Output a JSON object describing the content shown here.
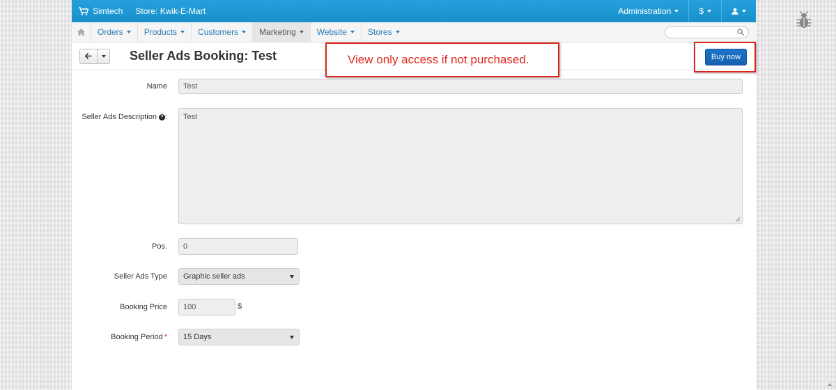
{
  "topbar": {
    "brand": "Simtech",
    "store": "Store: Kwik-E-Mart",
    "administration": "Administration",
    "currency": "$"
  },
  "nav": {
    "items": [
      "Orders",
      "Products",
      "Customers",
      "Marketing",
      "Website",
      "Stores"
    ],
    "active": "Marketing",
    "search_placeholder": ""
  },
  "header": {
    "title": "Seller Ads Booking: Test",
    "annotation": "View only access if not purchased.",
    "buy_label": "Buy now"
  },
  "form": {
    "name_label": "Name",
    "name_value": "Test",
    "description_label": "Seller Ads Description",
    "description_suffix": ":",
    "description_value": "Test",
    "pos_label": "Pos.",
    "pos_value": "0",
    "type_label": "Seller Ads Type",
    "type_value": "Graphic seller ads",
    "price_label": "Booking Price",
    "price_value": "100",
    "price_unit": "$",
    "period_label": "Booking Period",
    "period_required": "*",
    "period_value": "15 Days"
  },
  "colors": {
    "topbar": "#1f96d1",
    "link": "#2a7db8",
    "annotation_red": "#d9271e",
    "buy_button": "#1a6bc0"
  },
  "icons": [
    "cart-icon",
    "home-icon",
    "search-icon",
    "back-arrow-icon",
    "question-icon",
    "user-icon",
    "bug-icon"
  ]
}
